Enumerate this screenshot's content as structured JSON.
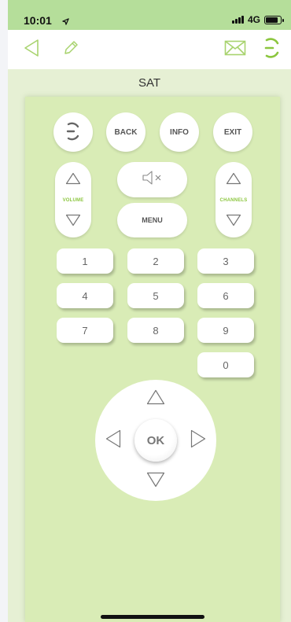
{
  "status": {
    "time": "10:01",
    "network": "4G"
  },
  "title": "SAT",
  "icons": {
    "back": "triangle-left-icon",
    "edit": "pencil-icon",
    "mail": "envelope-icon",
    "power": "power-icon",
    "mute": "speaker-mute-icon",
    "location": "location-arrow-icon"
  },
  "colors": {
    "accent": "#8cc63f",
    "status_bar": "#b5de9a",
    "panel": "#d9ecb6",
    "background": "#e6f0d4"
  },
  "remote": {
    "top_buttons": {
      "back": "BACK",
      "info": "INFO",
      "exit": "EXIT"
    },
    "volume_label": "VOLUME",
    "channels_label": "CHANNELS",
    "menu_label": "MENU",
    "keys": [
      "1",
      "2",
      "3",
      "4",
      "5",
      "6",
      "7",
      "8",
      "9",
      "0"
    ],
    "ok_label": "OK"
  }
}
